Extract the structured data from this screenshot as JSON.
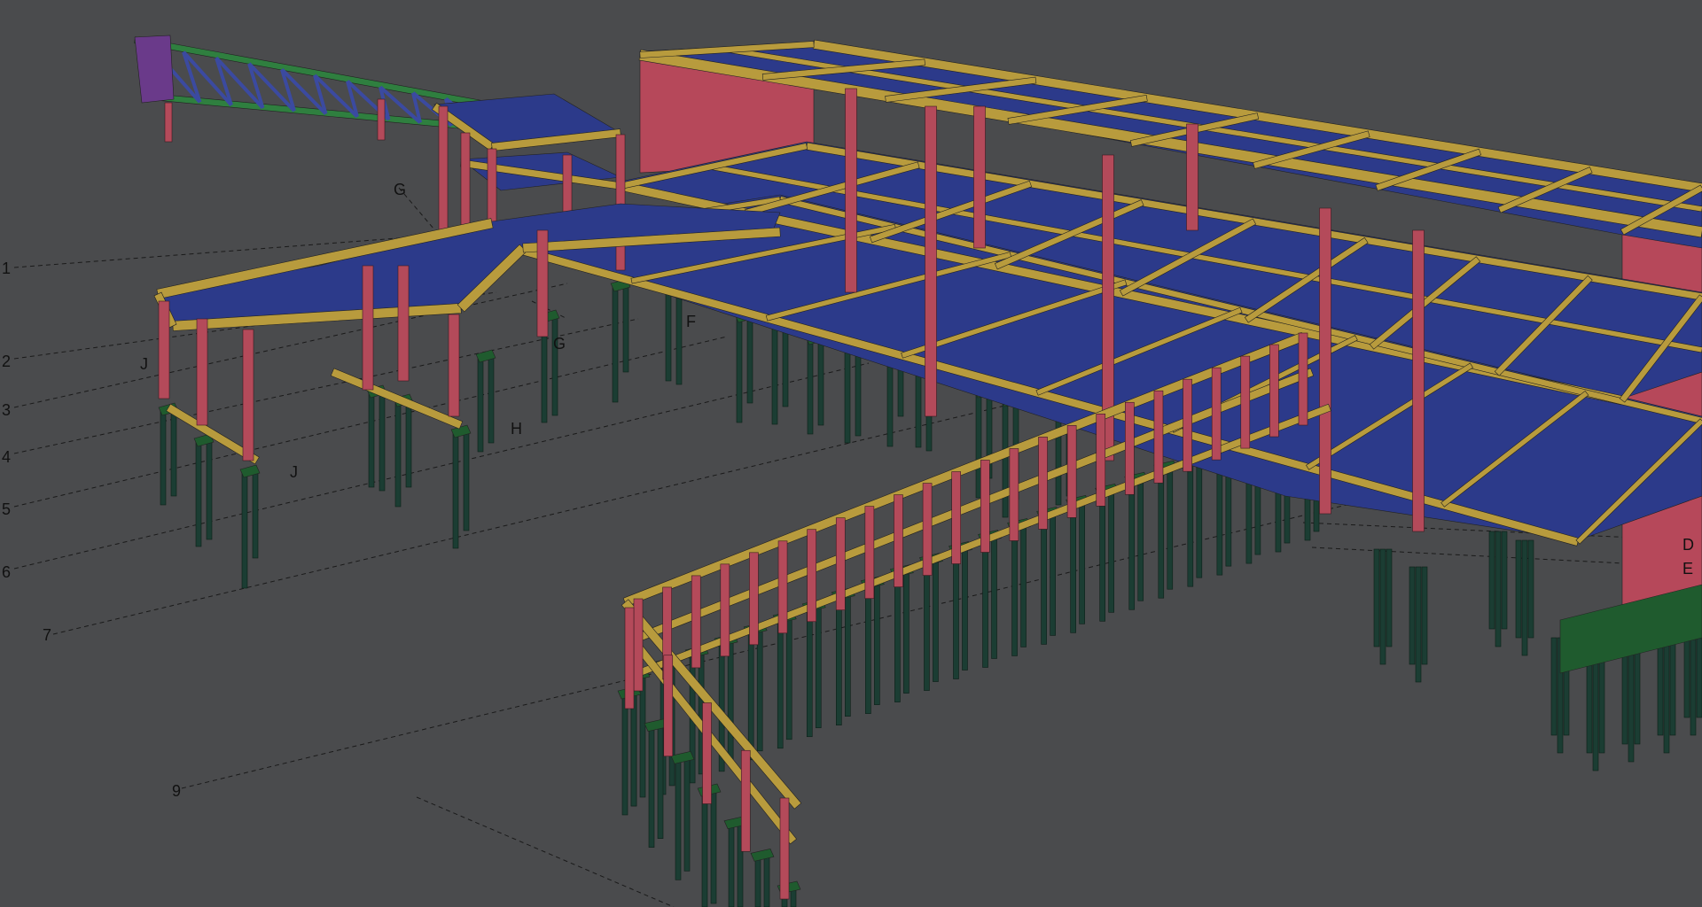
{
  "viewport": {
    "background": "#4a4b4d",
    "colors": {
      "slab": "#2c3a8a",
      "beam": "#b89b3d",
      "column": "#b44a5a",
      "wall": "#b6485a",
      "pile": "#1b3d33",
      "pile_cap": "#1f5b2e",
      "truss_chord": "#2f7f3f",
      "truss_web": "#3b4aa0",
      "gridline": "#1a1a1a"
    }
  },
  "grid_labels": {
    "l1": "1",
    "l2": "2",
    "l3": "3",
    "l4": "4",
    "l5": "5",
    "l6": "6",
    "l7": "7",
    "l9": "9",
    "lG1": "G",
    "lG2": "G",
    "lF": "F",
    "lH": "H",
    "lJ1": "J",
    "lJ2": "J",
    "lD": "D",
    "lE": "E"
  }
}
